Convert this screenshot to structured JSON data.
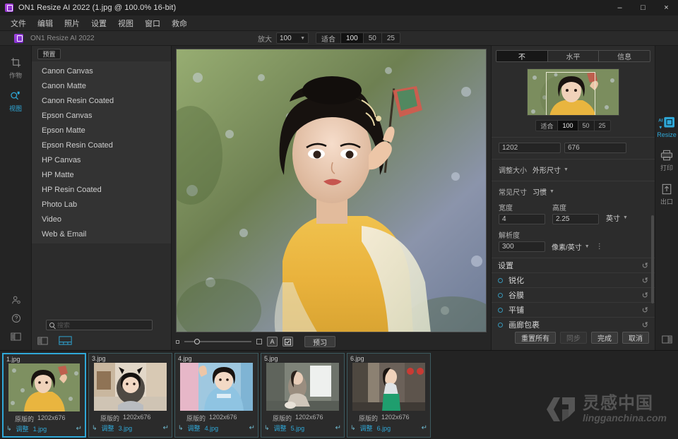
{
  "window": {
    "title": "ON1 Resize AI 2022 (1.jpg @ 100.0% 16-bit)",
    "minimize": "–",
    "maximize": "□",
    "close": "×"
  },
  "menubar": {
    "items": [
      "文件",
      "编辑",
      "照片",
      "设置",
      "视图",
      "窗口",
      "救命"
    ]
  },
  "appheader": {
    "app_name": "ON1 Resize AI 2022",
    "zoom_label": "放大",
    "zoom_value": "100",
    "fit_label": "适合",
    "fit_options": [
      "100",
      "50",
      "25"
    ],
    "fit_selected": "100"
  },
  "left_rail": {
    "items": [
      {
        "name": "crop",
        "label": "作物",
        "active": false
      },
      {
        "name": "view",
        "label": "视图",
        "active": true
      }
    ]
  },
  "presets": {
    "button_label": "预置",
    "items": [
      "Canon Canvas",
      "Canon Matte",
      "Canon Resin Coated",
      "Epson Canvas",
      "Epson Matte",
      "Epson Resin Coated",
      "HP Canvas",
      "HP Matte",
      "HP Resin Coated",
      "Photo Lab",
      "Video",
      "Web & Email"
    ],
    "search_placeholder": "搜索"
  },
  "canvas_bar": {
    "preview_label": "预习",
    "text_icon": "A",
    "check_icon": "☑"
  },
  "right_panel": {
    "tabs": [
      {
        "label": "不",
        "active": true
      },
      {
        "label": "水平",
        "active": false
      },
      {
        "label": "信息",
        "active": false
      }
    ],
    "nav_fit_label": "适合",
    "nav_fit_options": [
      "100",
      "50",
      "25"
    ],
    "nav_fit_selected": "100",
    "pixel_width": "1202",
    "pixel_height": "676",
    "resize_label": "调整大小",
    "resize_mode": "外形尺寸",
    "common_size_label": "常见尺寸",
    "common_size_value": "习惯",
    "width_label": "宽度",
    "width_value": "4",
    "height_label": "高度",
    "height_value": "2.25",
    "unit_value": "英寸",
    "resolution_label": "解析度",
    "resolution_value": "300",
    "resolution_unit": "像素/英寸",
    "sections": [
      {
        "label": "设置",
        "has_bullet": false
      },
      {
        "label": "锐化",
        "has_bullet": true
      },
      {
        "label": "谷膜",
        "has_bullet": true
      },
      {
        "label": "平铺",
        "has_bullet": true
      },
      {
        "label": "画廊包裹",
        "has_bullet": true
      }
    ],
    "reset_icon": "↺",
    "buttons": [
      {
        "label": "重置所有",
        "dim": false
      },
      {
        "label": "同步",
        "dim": true
      },
      {
        "label": "完成",
        "dim": false
      },
      {
        "label": "取消",
        "dim": false
      }
    ]
  },
  "far_rail": {
    "items": [
      {
        "name": "resize",
        "label": "Resize",
        "active": true
      },
      {
        "name": "print",
        "label": "打印",
        "active": false
      },
      {
        "name": "export",
        "label": "出口",
        "active": false
      }
    ]
  },
  "filmstrip": {
    "original_label": "原版的",
    "adjust_label": "调整",
    "items": [
      {
        "filename": "1.jpg",
        "dimensions": "1202x676",
        "output": "1.jpg",
        "selected": true
      },
      {
        "filename": "3.jpg",
        "dimensions": "1202x676",
        "output": "3.jpg",
        "selected": false
      },
      {
        "filename": "4.jpg",
        "dimensions": "1202x676",
        "output": "4.jpg",
        "selected": false
      },
      {
        "filename": "5.jpg",
        "dimensions": "1202x676",
        "output": "5.jpg",
        "selected": false
      },
      {
        "filename": "6.jpg",
        "dimensions": "1202x676",
        "output": "6.jpg",
        "selected": false
      }
    ]
  },
  "watermark": {
    "chinese": "灵感中国",
    "latin": "lingganchina.com"
  },
  "colors": {
    "accent": "#2fa8d8",
    "panel": "#2c2c2c",
    "background": "#262626",
    "brand": "#8c2fd0"
  }
}
